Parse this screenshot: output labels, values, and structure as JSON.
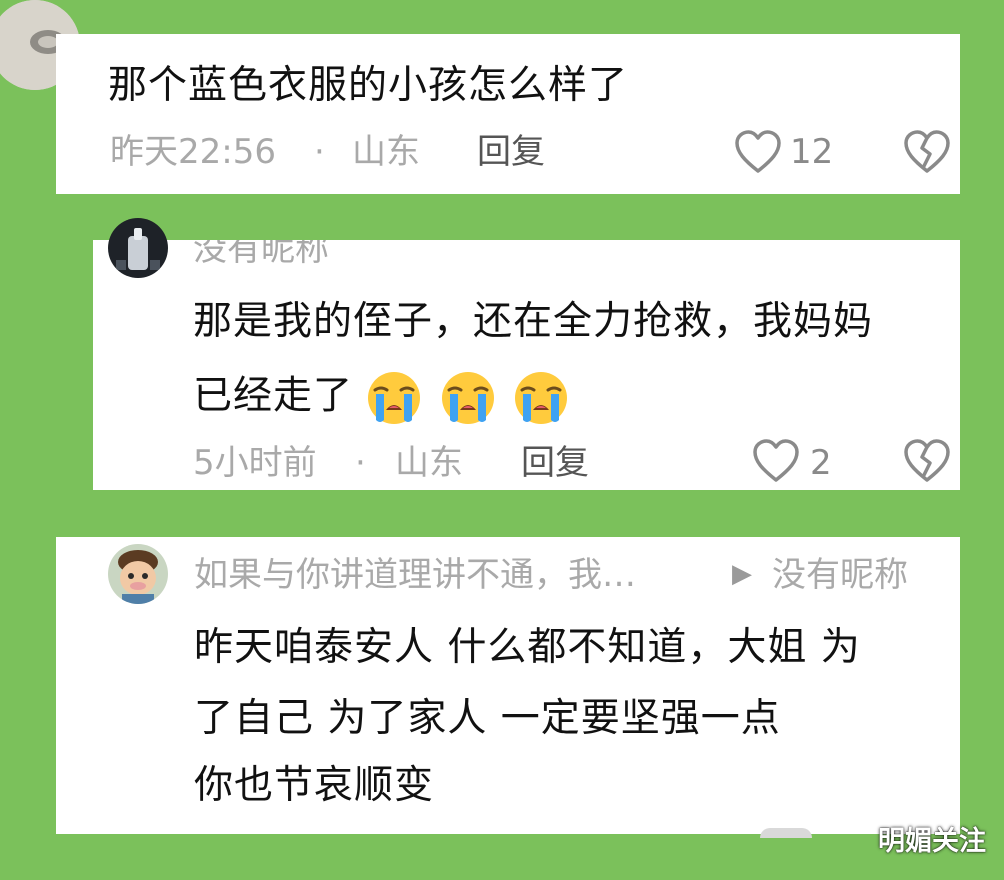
{
  "comments": [
    {
      "text_lines": [
        "那个蓝色衣服的小孩怎么样了"
      ],
      "time": "昨天22:56",
      "separator": "·",
      "location": "山东",
      "reply": "回复",
      "likes": "12",
      "icons": [
        "heart-outline-icon",
        "broken-heart-icon"
      ]
    },
    {
      "username": "没有昵称",
      "text_lines": [
        "那是我的侄子，还在全力抢救，我妈妈",
        "已经走了"
      ],
      "emojis": [
        "loudly-crying-face-emoji",
        "loudly-crying-face-emoji",
        "loudly-crying-face-emoji"
      ],
      "time": "5小时前",
      "separator": "·",
      "location": "山东",
      "reply": "回复",
      "likes": "2",
      "icons": [
        "heart-outline-icon",
        "broken-heart-icon"
      ]
    },
    {
      "username": "如果与你讲道理讲不通，我…",
      "reply_arrow": "▶",
      "reply_to": "没有昵称",
      "text_lines": [
        "昨天咱泰安人  什么都不知道，大姐  为",
        "了自己  为了家人   一定要坚强一点",
        "你也节哀顺变"
      ]
    }
  ],
  "watermark": "明媚关注",
  "colors": {
    "background": "#7bc15b",
    "card": "#ffffff",
    "meta": "#a9a9a9",
    "text": "#111111"
  }
}
